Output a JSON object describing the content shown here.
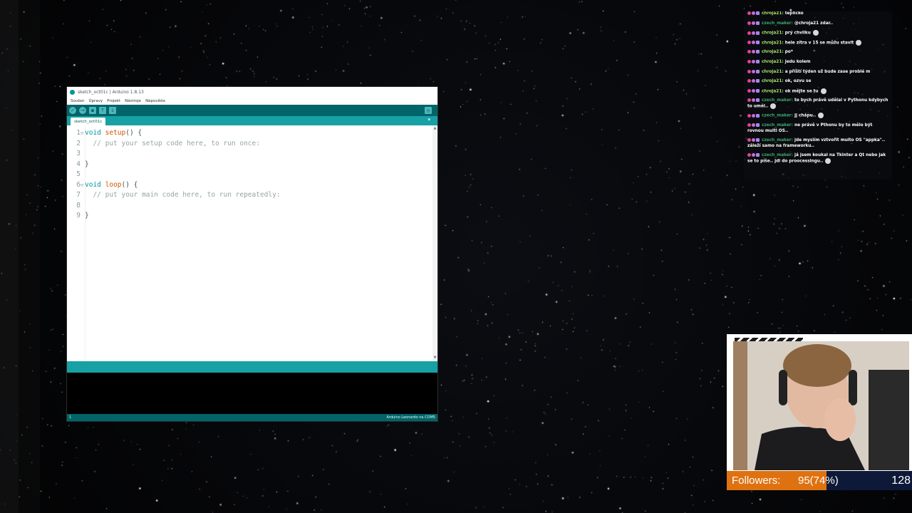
{
  "arduino": {
    "title": "sketch_oct01c | Arduino 1.8.13",
    "menu": [
      "Soubor",
      "Úpravy",
      "Projekt",
      "Nástroje",
      "Nápověda"
    ],
    "toolbar_icons": [
      "verify-icon",
      "upload-icon",
      "new-icon",
      "open-icon",
      "save-icon"
    ],
    "serial_monitor_icon": "magnifier-icon",
    "tab_label": "sketch_oct01c",
    "tab_menu_glyph": "▾",
    "code": [
      {
        "num": "1",
        "fold": "⊟",
        "kw": "void",
        "fn": "setup",
        "rest": "() {",
        "cmt": ""
      },
      {
        "num": "2",
        "fold": "",
        "kw": "",
        "fn": "",
        "rest": "  ",
        "cmt": "// put your setup code here, to run once:"
      },
      {
        "num": "3",
        "fold": "",
        "kw": "",
        "fn": "",
        "rest": "",
        "cmt": ""
      },
      {
        "num": "4",
        "fold": "",
        "kw": "",
        "fn": "",
        "rest": "}",
        "cmt": ""
      },
      {
        "num": "5",
        "fold": "",
        "kw": "",
        "fn": "",
        "rest": "",
        "cmt": ""
      },
      {
        "num": "6",
        "fold": "⊟",
        "kw": "void",
        "fn": "loop",
        "rest": "() {",
        "cmt": ""
      },
      {
        "num": "7",
        "fold": "",
        "kw": "",
        "fn": "",
        "rest": "  ",
        "cmt": "// put your main code here, to run repeatedly:"
      },
      {
        "num": "8",
        "fold": "",
        "kw": "",
        "fn": "",
        "rest": "",
        "cmt": ""
      },
      {
        "num": "9",
        "fold": "",
        "kw": "",
        "fn": "",
        "rest": "}",
        "cmt": ""
      }
    ],
    "status_line": "1",
    "board": "Arduino Leonardo na COM5",
    "colors": {
      "teal_dark": "#006468",
      "teal": "#17a1a5",
      "keyword": "#00979c",
      "function": "#d35400"
    }
  },
  "chat": {
    "messages": [
      {
        "user": "chroja21",
        "color": "user-c",
        "text": "teplíčko",
        "emote": false
      },
      {
        "user": "czech_maker",
        "color": "user-z",
        "text": "@chroja21 zdar..",
        "emote": false
      },
      {
        "user": "chroja21",
        "color": "user-c",
        "text": "prý chvilku",
        "emote": true
      },
      {
        "user": "chroja21",
        "color": "user-c",
        "text": "hele zítra v 15 se můžu stavit",
        "emote": true
      },
      {
        "user": "chroja21",
        "color": "user-c",
        "text": "po*",
        "emote": false
      },
      {
        "user": "chroja21",
        "color": "user-c",
        "text": "jedu kolem",
        "emote": false
      },
      {
        "user": "chroja21",
        "color": "user-c",
        "text": "a příští týden už bude zase problé m",
        "emote": false
      },
      {
        "user": "chroja21",
        "color": "user-c",
        "text": "ok, ozvu se",
        "emote": false
      },
      {
        "user": "chroja21",
        "color": "user-c",
        "text": "ok mějte se tu",
        "emote": true
      },
      {
        "user": "czech_maker",
        "color": "user-z",
        "text": "to bych právě udělal v Pythonu kdybych to uměl..",
        "emote": true
      },
      {
        "user": "czech_maker",
        "color": "user-z",
        "text": "jj chápu..",
        "emote": true
      },
      {
        "user": "czech_maker",
        "color": "user-z",
        "text": "ne právě v Pthonu by to mělo být rovnou multi OS..",
        "emote": false
      },
      {
        "user": "czech_maker",
        "color": "user-z",
        "text": "jde myslím vztvořit multo OS \"appka\".. záleží samo na frameworku..",
        "emote": false
      },
      {
        "user": "czech_maker",
        "color": "user-z",
        "text": "já jsem koukal na Tkinter a Qt nebo jak se to píše.. jdi do proocessingu..",
        "emote": true
      }
    ]
  },
  "followers": {
    "label": "Followers:",
    "value": "95(74%)",
    "goal": "128",
    "progress_fraction": 0.74,
    "colors": {
      "fill": "#df7210",
      "track": "#0e1838"
    }
  }
}
